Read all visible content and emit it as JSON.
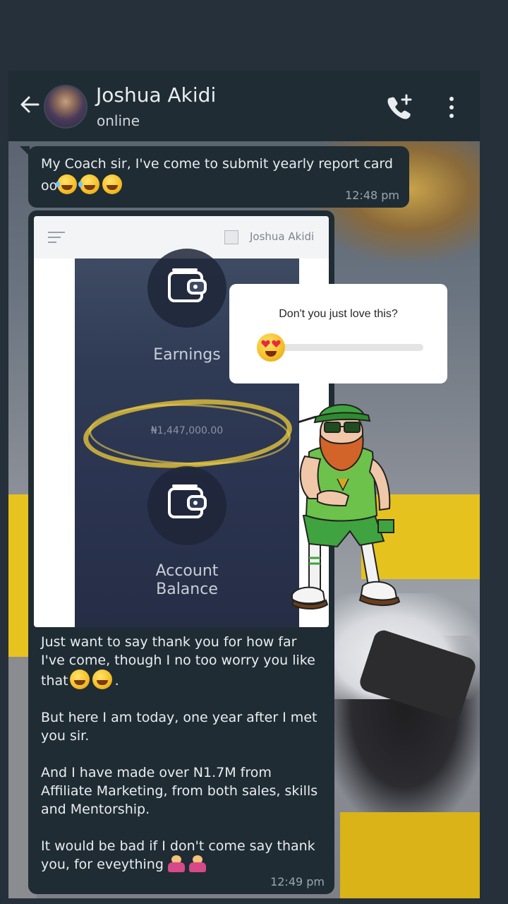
{
  "chat": {
    "contact_name": "Joshua Akidi",
    "status": "online"
  },
  "messages": [
    {
      "text": "My Coach sir, I've come to submit yearly report card oo",
      "time": "12:48 pm"
    },
    {
      "screenshot": {
        "username": "Joshua Akidi",
        "earnings_label": "Earnings",
        "amount": "₦1,447,000.00",
        "balance_label_line1": "Account",
        "balance_label_line2": "Balance"
      },
      "paragraphs": [
        "Just want to say thank you for how far I've come, though I no too worry you like that",
        "But here I am today, one year after I met you sir.",
        "And I have made over N1.7M from Affiliate Marketing, from both sales, skills and Mentorship.",
        "It would be bad if I don't come say thank you, for eveything"
      ],
      "time": "12:49 pm"
    }
  ],
  "poll": {
    "question": "Don't you just love this?",
    "emoji": "smiling-face-with-heart-eyes",
    "slider_value": 0.08
  },
  "colors": {
    "header_bg": "#1f2c34",
    "bubble_bg": "#1f2c34",
    "highlight_ring": "#d8bb3b"
  }
}
